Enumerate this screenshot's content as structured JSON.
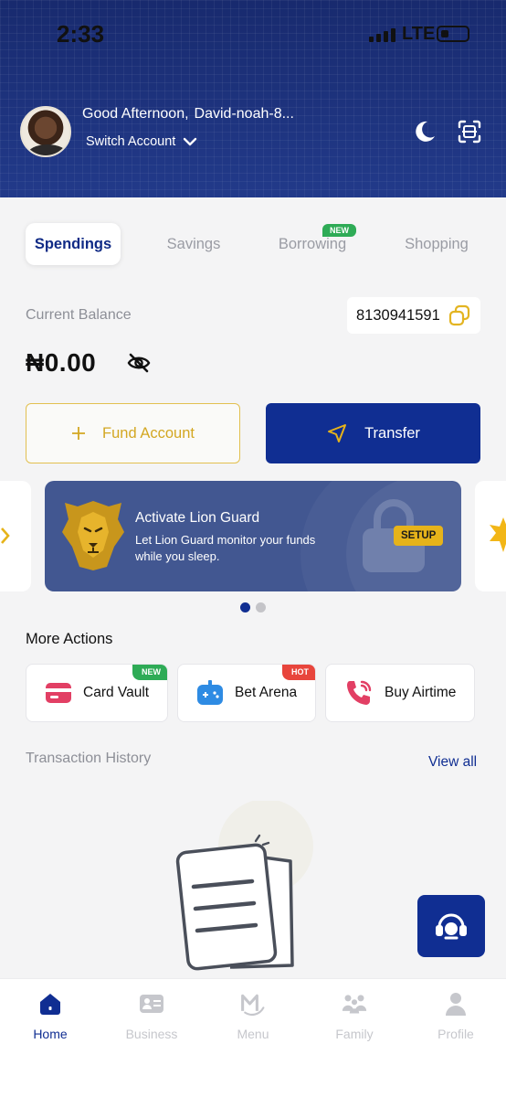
{
  "status_bar": {
    "time": "2:33",
    "network": "LTE"
  },
  "header": {
    "greeting": "Good Afternoon,",
    "user_name": "David-noah-8...",
    "switch_account": "Switch Account",
    "icons": [
      "moon-icon",
      "scan-icon"
    ]
  },
  "tabs": [
    {
      "label": "Spendings",
      "active": true
    },
    {
      "label": "Savings"
    },
    {
      "label": "Borrowing",
      "badge": "NEW"
    },
    {
      "label": "Shopping"
    }
  ],
  "balance": {
    "label": "Current Balance",
    "account_number": "8130941591",
    "amount": "₦0.00"
  },
  "buttons": {
    "fund": "Fund Account",
    "transfer": "Transfer"
  },
  "banner": {
    "title": "Activate Lion Guard",
    "description": "Let Lion Guard monitor your funds while you sleep.",
    "cta": "SETUP",
    "page_count": 2,
    "active_page": 1
  },
  "more_actions": {
    "title": "More Actions",
    "items": [
      {
        "label": "Card Vault",
        "badge": "NEW",
        "badge_color": "#2eab56"
      },
      {
        "label": "Bet Arena",
        "badge": "HOT",
        "badge_color": "#e8453c"
      },
      {
        "label": "Buy Airtime"
      }
    ]
  },
  "transactions": {
    "title": "Transaction History",
    "view_all": "View all"
  },
  "bottom_nav": [
    {
      "label": "Home",
      "icon": "home-icon",
      "active": true
    },
    {
      "label": "Business",
      "icon": "business-card-icon"
    },
    {
      "label": "Menu",
      "icon": "m-logo-icon"
    },
    {
      "label": "Family",
      "icon": "family-icon"
    },
    {
      "label": "Profile",
      "icon": "profile-icon"
    }
  ],
  "colors": {
    "primary": "#102e92",
    "accent": "#e6b31a",
    "banner": "#425791",
    "header": "#1b2f7a"
  }
}
